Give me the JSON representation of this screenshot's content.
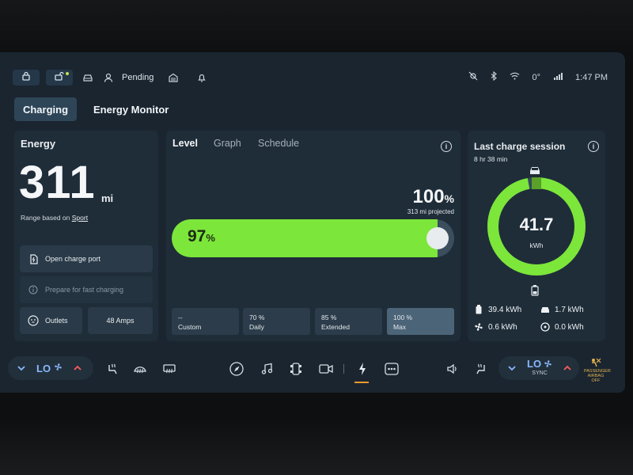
{
  "statusbar": {
    "profile_label": "Pending",
    "temperature": "0°",
    "time": "1:47 PM",
    "icons": [
      "lock-icon",
      "unlock-icon",
      "car-icon",
      "person-icon",
      "garage-icon",
      "bell-icon",
      "no-camera-icon",
      "bluetooth-icon",
      "wifi-icon",
      "lte-signal-icon"
    ]
  },
  "tabs": {
    "charging": "Charging",
    "energy_monitor": "Energy Monitor"
  },
  "energy": {
    "title": "Energy",
    "range_value": "311",
    "range_unit": "mi",
    "range_based_prefix": "Range based on",
    "range_mode": "Sport",
    "open_port_label": "Open charge port",
    "prepare_label": "Prepare for fast charging",
    "outlets_label": "Outlets",
    "amps_label": "48 Amps"
  },
  "level": {
    "tab_level": "Level",
    "tab_graph": "Graph",
    "tab_schedule": "Schedule",
    "target_value": "100",
    "target_unit": "%",
    "projected": "313 mi projected",
    "current_value": "97",
    "current_unit": "%",
    "current_fraction": 0.97,
    "presets": [
      {
        "value": "--",
        "name": "Custom",
        "selected": false
      },
      {
        "value": "70 %",
        "name": "Daily",
        "selected": false
      },
      {
        "value": "85 %",
        "name": "Extended",
        "selected": false
      },
      {
        "value": "100 %",
        "name": "Max",
        "selected": true
      }
    ]
  },
  "session": {
    "title": "Last charge session",
    "duration": "8 hr 38 min",
    "total_value": "41.7",
    "total_unit": "kWh",
    "ring_fraction": 0.97,
    "stats": {
      "battery": "39.4 kWh",
      "cabin": "1.7 kWh",
      "climate": "0.6 kWh",
      "other": "0.0 kWh"
    }
  },
  "climate": {
    "left_level": "LO",
    "right_level": "LO",
    "right_sync": "SYNC",
    "airbag_line1": "PASSENGER",
    "airbag_line2": "AIRBAG OFF"
  },
  "colors": {
    "accent_green": "#7ce63a",
    "screen_bg": "#1a2530",
    "panel_bg": "#1f2d39",
    "fan_blue": "#8ab8ff",
    "warning_orange": "#f29b2e"
  }
}
